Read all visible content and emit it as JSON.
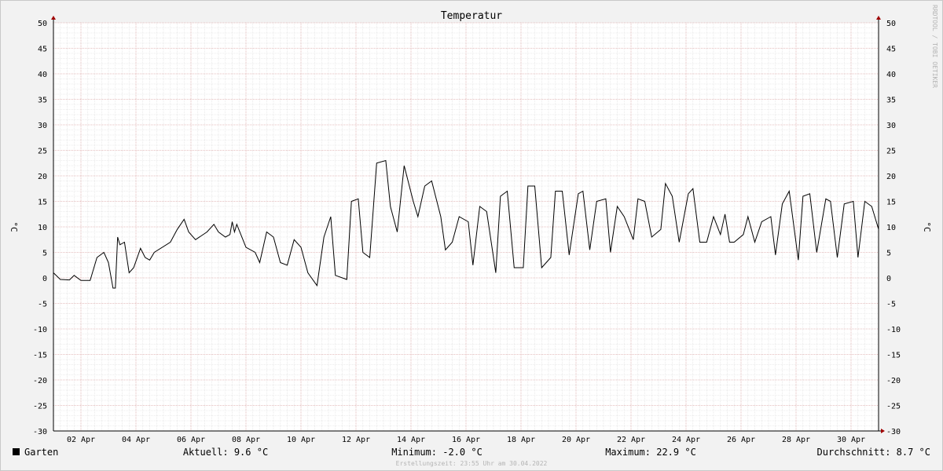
{
  "chart_data": {
    "type": "line",
    "title": "Temperatur",
    "ylabel": "°C",
    "ylim": [
      -30,
      50
    ],
    "ytick_step": 5,
    "xlim": [
      "2022-04-01T00:00",
      "2022-05-01T00:00"
    ],
    "xticks": [
      {
        "label": "02 Apr",
        "x": "2022-04-02T00:00"
      },
      {
        "label": "04 Apr",
        "x": "2022-04-04T00:00"
      },
      {
        "label": "06 Apr",
        "x": "2022-04-06T00:00"
      },
      {
        "label": "08 Apr",
        "x": "2022-04-08T00:00"
      },
      {
        "label": "10 Apr",
        "x": "2022-04-10T00:00"
      },
      {
        "label": "12 Apr",
        "x": "2022-04-12T00:00"
      },
      {
        "label": "14 Apr",
        "x": "2022-04-14T00:00"
      },
      {
        "label": "16 Apr",
        "x": "2022-04-16T00:00"
      },
      {
        "label": "18 Apr",
        "x": "2022-04-18T00:00"
      },
      {
        "label": "20 Apr",
        "x": "2022-04-20T00:00"
      },
      {
        "label": "22 Apr",
        "x": "2022-04-22T00:00"
      },
      {
        "label": "24 Apr",
        "x": "2022-04-24T00:00"
      },
      {
        "label": "26 Apr",
        "x": "2022-04-26T00:00"
      },
      {
        "label": "28 Apr",
        "x": "2022-04-28T00:00"
      },
      {
        "label": "30 Apr",
        "x": "2022-04-30T00:00"
      }
    ],
    "grid": true,
    "series": [
      {
        "name": "Garten",
        "color": "#000000",
        "x": [
          "2022-04-01T00:00",
          "2022-04-01T06:00",
          "2022-04-01T14:00",
          "2022-04-01T18:00",
          "2022-04-02T00:00",
          "2022-04-02T08:00",
          "2022-04-02T14:00",
          "2022-04-02T20:00",
          "2022-04-03T00:00",
          "2022-04-03T04:00",
          "2022-04-03T06:00",
          "2022-04-03T08:00",
          "2022-04-03T10:00",
          "2022-04-03T14:00",
          "2022-04-03T18:00",
          "2022-04-03T22:00",
          "2022-04-04T04:00",
          "2022-04-04T08:00",
          "2022-04-04T12:00",
          "2022-04-04T16:00",
          "2022-04-05T06:00",
          "2022-04-05T12:00",
          "2022-04-05T18:00",
          "2022-04-05T22:00",
          "2022-04-06T04:00",
          "2022-04-06T14:00",
          "2022-04-06T20:00",
          "2022-04-07T00:00",
          "2022-04-07T06:00",
          "2022-04-07T10:00",
          "2022-04-07T12:00",
          "2022-04-07T14:00",
          "2022-04-07T16:00",
          "2022-04-08T00:00",
          "2022-04-08T08:00",
          "2022-04-08T12:00",
          "2022-04-08T18:00",
          "2022-04-09T00:00",
          "2022-04-09T06:00",
          "2022-04-09T12:00",
          "2022-04-09T18:00",
          "2022-04-10T00:00",
          "2022-04-10T06:00",
          "2022-04-10T14:00",
          "2022-04-10T20:00",
          "2022-04-11T02:00",
          "2022-04-11T06:00",
          "2022-04-11T16:00",
          "2022-04-11T20:00",
          "2022-04-12T02:00",
          "2022-04-12T06:00",
          "2022-04-12T12:00",
          "2022-04-12T18:00",
          "2022-04-13T02:00",
          "2022-04-13T06:00",
          "2022-04-13T12:00",
          "2022-04-13T18:00",
          "2022-04-14T02:00",
          "2022-04-14T06:00",
          "2022-04-14T12:00",
          "2022-04-14T18:00",
          "2022-04-15T02:00",
          "2022-04-15T06:00",
          "2022-04-15T12:00",
          "2022-04-15T18:00",
          "2022-04-16T02:00",
          "2022-04-16T06:00",
          "2022-04-16T12:00",
          "2022-04-16T18:00",
          "2022-04-17T02:00",
          "2022-04-17T06:00",
          "2022-04-17T12:00",
          "2022-04-17T18:00",
          "2022-04-18T02:00",
          "2022-04-18T06:00",
          "2022-04-18T12:00",
          "2022-04-18T18:00",
          "2022-04-19T02:00",
          "2022-04-19T06:00",
          "2022-04-19T12:00",
          "2022-04-19T18:00",
          "2022-04-20T02:00",
          "2022-04-20T06:00",
          "2022-04-20T12:00",
          "2022-04-20T18:00",
          "2022-04-21T02:00",
          "2022-04-21T06:00",
          "2022-04-21T12:00",
          "2022-04-21T18:00",
          "2022-04-22T02:00",
          "2022-04-22T06:00",
          "2022-04-22T12:00",
          "2022-04-22T18:00",
          "2022-04-23T02:00",
          "2022-04-23T06:00",
          "2022-04-23T12:00",
          "2022-04-23T18:00",
          "2022-04-24T02:00",
          "2022-04-24T06:00",
          "2022-04-24T12:00",
          "2022-04-24T18:00",
          "2022-04-25T00:00",
          "2022-04-25T06:00",
          "2022-04-25T10:00",
          "2022-04-25T14:00",
          "2022-04-25T18:00",
          "2022-04-26T02:00",
          "2022-04-26T06:00",
          "2022-04-26T12:00",
          "2022-04-26T18:00",
          "2022-04-27T02:00",
          "2022-04-27T06:00",
          "2022-04-27T12:00",
          "2022-04-27T18:00",
          "2022-04-28T02:00",
          "2022-04-28T06:00",
          "2022-04-28T12:00",
          "2022-04-28T18:00",
          "2022-04-29T02:00",
          "2022-04-29T06:00",
          "2022-04-29T12:00",
          "2022-04-29T18:00",
          "2022-04-30T02:00",
          "2022-04-30T06:00",
          "2022-04-30T12:00",
          "2022-04-30T18:00",
          "2022-04-30T23:55"
        ],
        "values": [
          1.0,
          -0.3,
          -0.4,
          0.5,
          -0.5,
          -0.5,
          4.0,
          5.0,
          3.0,
          -2.0,
          -2.0,
          8.0,
          6.5,
          7.0,
          1.0,
          2.0,
          5.8,
          4.0,
          3.5,
          5.0,
          7.0,
          9.5,
          11.5,
          9.0,
          7.5,
          9.0,
          10.5,
          9.0,
          8.0,
          8.5,
          11.0,
          9.0,
          10.5,
          6.0,
          5.0,
          3.0,
          9.0,
          8.0,
          3.0,
          2.5,
          7.5,
          6.0,
          1.0,
          -1.5,
          8.0,
          12.0,
          0.5,
          -0.3,
          15.0,
          15.5,
          5.0,
          4.0,
          22.5,
          23.0,
          14.0,
          9.0,
          22.0,
          15.0,
          12.0,
          18.0,
          19.0,
          12.0,
          5.5,
          7.0,
          12.0,
          11.0,
          2.5,
          14.0,
          13.0,
          1.0,
          16.0,
          17.0,
          2.0,
          2.0,
          18.0,
          18.0,
          2.0,
          4.0,
          17.0,
          17.0,
          4.5,
          16.5,
          17.0,
          5.5,
          15.0,
          15.5,
          5.0,
          14.0,
          12.0,
          7.5,
          15.5,
          15.0,
          8.0,
          9.5,
          18.5,
          16.0,
          7.0,
          16.5,
          17.5,
          7.0,
          7.0,
          12.0,
          8.5,
          12.5,
          7.0,
          7.0,
          8.5,
          12.0,
          7.0,
          11.0,
          12.0,
          4.5,
          14.5,
          17.0,
          3.5,
          16.0,
          16.5,
          5.0,
          15.5,
          15.0,
          4.0,
          14.5,
          15.0,
          4.0,
          15.0,
          14.0,
          9.6
        ]
      }
    ]
  },
  "legend": {
    "series_name": "Garten",
    "series_color": "#000000",
    "aktuell": "Aktuell: 9.6 °C",
    "minimum": "Minimum: -2.0 °C",
    "maximum": "Maximum: 22.9 °C",
    "durchschnitt": "Durchschnitt: 8.7 °C"
  },
  "footer": {
    "created": "Erstellungszeit: 23:55 Uhr am 30.04.2022"
  },
  "watermark": "RRDTOOL / TOBI OETIKER",
  "colors": {
    "canvas": "#ffffff",
    "background": "#f2f2f2",
    "major_grid": "#e2b0b0",
    "minor_grid": "#dcdcdc",
    "axis": "#000000",
    "arrow": "#a00000",
    "line": "#000000"
  }
}
